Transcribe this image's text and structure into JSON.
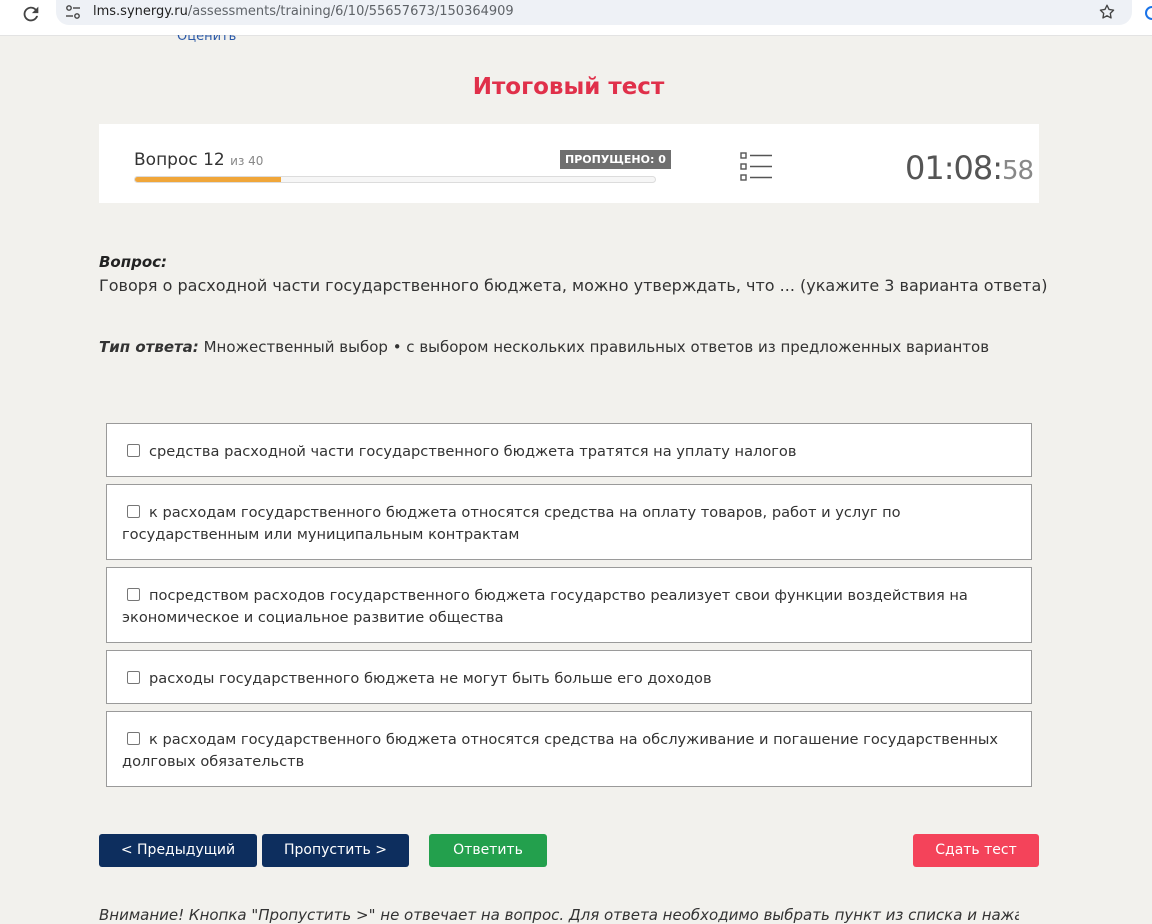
{
  "browser": {
    "url_host": "lms.synergy.ru",
    "url_path": "/assessments/training/6/10/55657673/150364909"
  },
  "top_link": "Оценить",
  "page_title": "Итоговый тест",
  "progress": {
    "question_label": "Вопрос 12",
    "of_label": "из 40",
    "skipped_label": "ПРОПУЩЕНО: 0",
    "fraction_done": 0.28,
    "timer_main": "01:08:",
    "timer_seconds": "58"
  },
  "question": {
    "heading": "Вопрос:",
    "text": "Говоря о расходной части государственного бюджета, можно утверждать, что ... (укажите 3 варианта ответа)",
    "type_label": "Тип ответа:",
    "type_value": "Множественный выбор • с выбором нескольких правильных ответов из предложенных вариантов"
  },
  "options": [
    {
      "text": "средства расходной части государственного бюджета тратятся на уплату налогов",
      "checked": false
    },
    {
      "text": "к расходам государственного бюджета относятся средства на оплату товаров, работ и услуг по государственным или муниципальным контрактам",
      "checked": false
    },
    {
      "text": "посредством расходов государственного бюджета государство реализует свои функции воздействия на экономическое и социальное развитие общества",
      "checked": false
    },
    {
      "text": "расходы государственного бюджета не могут быть больше его доходов",
      "checked": false
    },
    {
      "text": "к расходам государственного бюджета относятся средства на обслуживание и погашение государственных долговых обязательств",
      "checked": false
    }
  ],
  "buttons": {
    "prev": "< Предыдущий",
    "skip": "Пропустить >",
    "answer": "Ответить",
    "finish": "Сдать тест"
  },
  "warning_text": "Внимание! Кнопка \"Пропустить >\" не отвечает на вопрос. Для ответа необходимо выбрать пункт из списка и нажать",
  "colors": {
    "title": "#e0304a",
    "navy_button": "#0d2e5e",
    "green_button": "#23a04d",
    "red_button": "#f4435a",
    "progress_fill": "#f0a63a"
  }
}
